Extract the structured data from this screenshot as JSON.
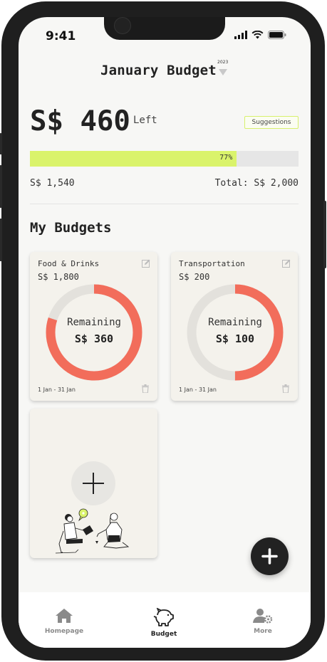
{
  "status_bar": {
    "time": "9:41"
  },
  "header": {
    "title": "January Budget",
    "year": "2023"
  },
  "summary": {
    "remaining_amount": "S$ 460",
    "remaining_label": "Left",
    "suggestions_button": "Suggestions",
    "progress_percent": 77,
    "progress_label": "77%",
    "spent": "S$ 1,540",
    "total": "Total: S$ 2,000"
  },
  "section_title": "My Budgets",
  "budgets": [
    {
      "category": "Food & Drinks",
      "limit": "S$ 1,800",
      "remaining_label": "Remaining",
      "remaining": "S$ 360",
      "remaining_fraction": 0.2,
      "date_range": "1 Jan - 31 Jan"
    },
    {
      "category": "Transportation",
      "limit": "S$ 200",
      "remaining_label": "Remaining",
      "remaining": "S$ 100",
      "remaining_fraction": 0.5,
      "date_range": "1 Jan - 31 Jan"
    }
  ],
  "nav": [
    {
      "label": "Homepage",
      "icon": "home-icon",
      "active": false
    },
    {
      "label": "Budget",
      "icon": "piggy-bank-icon",
      "active": true
    },
    {
      "label": "More",
      "icon": "user-settings-icon",
      "active": false
    }
  ],
  "colors": {
    "accent": "#daf36b",
    "ring_spent": "#f26d5b",
    "ring_remaining": "#e3e1dc",
    "dark": "#222222"
  }
}
